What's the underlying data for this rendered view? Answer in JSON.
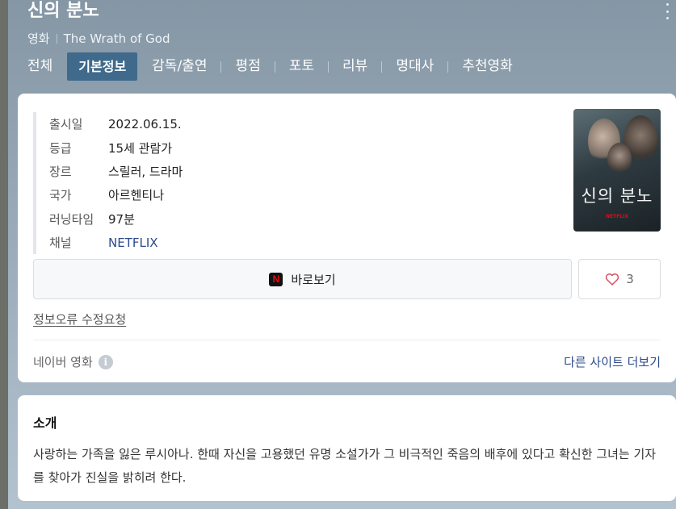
{
  "header": {
    "title": "신의 분노",
    "category": "영화",
    "original_title": "The Wrath of God"
  },
  "tabs": [
    {
      "label": "전체"
    },
    {
      "label": "기본정보",
      "active": true
    },
    {
      "label": "감독/출연"
    },
    {
      "label": "평점"
    },
    {
      "label": "포토"
    },
    {
      "label": "리뷰"
    },
    {
      "label": "명대사"
    },
    {
      "label": "추천영화"
    }
  ],
  "info": {
    "rows": [
      {
        "key": "출시일",
        "value": "2022.06.15."
      },
      {
        "key": "등급",
        "value": "15세 관람가"
      },
      {
        "key": "장르",
        "value": "스릴러, 드라마"
      },
      {
        "key": "국가",
        "value": "아르헨티나"
      },
      {
        "key": "러닝타임",
        "value": "97분"
      },
      {
        "key": "채널",
        "value": "NETFLIX"
      }
    ]
  },
  "poster": {
    "title": "신의 분노",
    "badge": "NETFLIX"
  },
  "actions": {
    "watch_label": "바로보기",
    "watch_icon": "netflix-icon",
    "like_count": "3",
    "like_icon": "heart-icon"
  },
  "report_link": "정보오류 수정요청",
  "source": {
    "label": "네이버 영화",
    "icon": "info-icon",
    "more_sites": "다른 사이트 더보기"
  },
  "intro": {
    "title": "소개",
    "text": "사랑하는 가족을 잃은 루시아나. 한때 자신을 고용했던 유명 소설가가 그 비극적인 죽음의 배후에 있다고 확신한 그녀는 기자를 찾아가 진실을 밝히려 한다."
  },
  "colors": {
    "accent": "#3f6a8c",
    "link": "#2c4a8a",
    "netflix_red": "#e50914"
  }
}
